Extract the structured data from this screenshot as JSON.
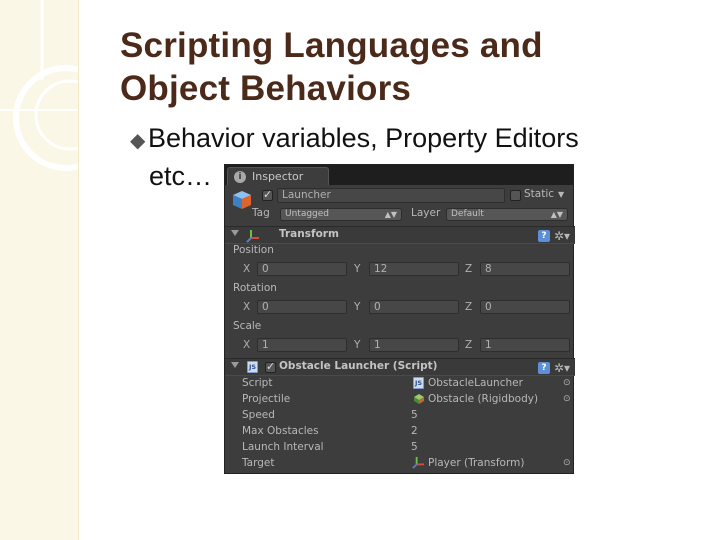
{
  "slide": {
    "title_line1": "Scripting Languages and",
    "title_line2": "Object Behaviors",
    "bullet_glyph": "◆",
    "bullet_text": "Behavior variables, Property Editors",
    "bullet_cont": "etc…"
  },
  "colors": {
    "title": "#4b2a1a",
    "side_strip": "#fbf7e6",
    "inspector_bg": "#3d3d3d",
    "inspector_tabbar": "#1e1e1e"
  },
  "inspector": {
    "tab_label": "Inspector",
    "info_glyph": "i",
    "object_name": "Launcher",
    "static_label": "Static",
    "dropdown_arrow": "▼",
    "tag_label": "Tag",
    "tag_value": "Untagged",
    "layer_label": "Layer",
    "layer_value": "Default",
    "popup_arrows": "▲▼",
    "help_glyph": "?",
    "gear_glyph": "✲▾",
    "transform": {
      "title": "Transform",
      "position_label": "Position",
      "rotation_label": "Rotation",
      "scale_label": "Scale",
      "axis_x": "X",
      "axis_y": "Y",
      "axis_z": "Z",
      "position": {
        "x": "0",
        "y": "12",
        "z": "8"
      },
      "rotation": {
        "x": "0",
        "y": "0",
        "z": "0"
      },
      "scale": {
        "x": "1",
        "y": "1",
        "z": "1"
      }
    },
    "script_component": {
      "title": "Obstacle Launcher (Script)",
      "js_glyph": "JS",
      "circle_glyph": "⊙",
      "props": [
        {
          "label": "Script",
          "value": "ObstacleLauncher",
          "icon": "js-icon",
          "picker": true
        },
        {
          "label": "Projectile",
          "value": "Obstacle (Rigidbody)",
          "icon": "rigidbody-icon",
          "picker": true
        },
        {
          "label": "Speed",
          "value": "5",
          "icon": "",
          "picker": false
        },
        {
          "label": "Max Obstacles",
          "value": "2",
          "icon": "",
          "picker": false
        },
        {
          "label": "Launch Interval",
          "value": "5",
          "icon": "",
          "picker": false
        },
        {
          "label": "Target",
          "value": "Player (Transform)",
          "icon": "transform-icon",
          "picker": true
        }
      ]
    }
  }
}
